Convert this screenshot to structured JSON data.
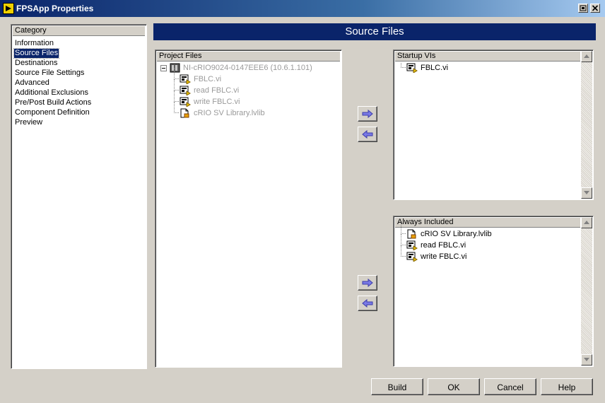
{
  "window": {
    "title": "FPSApp Properties"
  },
  "category": {
    "header": "Category",
    "items": [
      "Information",
      "Source Files",
      "Destinations",
      "Source File Settings",
      "Advanced",
      "Additional Exclusions",
      "Pre/Post Build Actions",
      "Component Definition",
      "Preview"
    ],
    "selected_index": 1
  },
  "section": {
    "title": "Source Files"
  },
  "project_files": {
    "header": "Project Files",
    "root": {
      "label": "NI-cRIO9024-0147EEE6 (10.6.1.101)",
      "expand": "⊟",
      "icon": "crio-target-icon"
    },
    "items": [
      {
        "label": "FBLC.vi",
        "icon": "vi-icon"
      },
      {
        "label": "read FBLC.vi",
        "icon": "vi-icon"
      },
      {
        "label": "write FBLC.vi",
        "icon": "vi-icon"
      },
      {
        "label": "cRIO SV Library.lvlib",
        "icon": "library-icon"
      }
    ]
  },
  "startup_vis": {
    "header": "Startup VIs",
    "items": [
      {
        "label": "FBLC.vi",
        "icon": "vi-icon"
      }
    ]
  },
  "always_included": {
    "header": "Always Included",
    "items": [
      {
        "label": "cRIO SV Library.lvlib",
        "icon": "library-icon"
      },
      {
        "label": "read FBLC.vi",
        "icon": "vi-icon"
      },
      {
        "label": "write FBLC.vi",
        "icon": "vi-icon"
      }
    ]
  },
  "buttons": {
    "build": "Build",
    "ok": "OK",
    "cancel": "Cancel",
    "help": "Help"
  },
  "colors": {
    "selection": "#0a246a",
    "banner": "#0a246a",
    "arrow": "#6a6adc",
    "face": "#d4d0c8"
  }
}
